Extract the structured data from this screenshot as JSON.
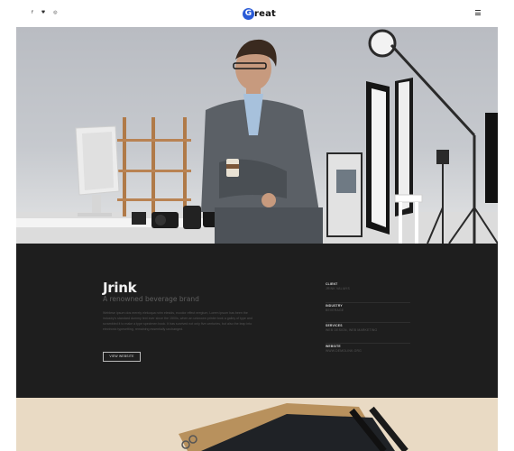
{
  "header": {
    "social_icons": [
      {
        "name": "facebook-icon",
        "glyph": "f"
      },
      {
        "name": "twitter-icon",
        "glyph": "♥"
      },
      {
        "name": "instagram-icon",
        "glyph": "◎"
      }
    ],
    "logo_mark": "G",
    "logo_text": "reat"
  },
  "project": {
    "title": "Jrink",
    "subtitle": "A renowned beverage brand",
    "description": "Weblese ipsum dos merely elekoqua rohn elesids, eccolor effect eregium, Lorem ipsum has been the industry's standard dummy text ever since the 1500s, when an unknown printer took a galley of type and scrambled it to make a type specimen book. It has survived not only five centuries, but also the leap into electronic typesetting, remaining essentially unchanged.",
    "button_label": "VIEW WEBSITE",
    "meta": [
      {
        "label": "CLIENT",
        "value": "JRINK VALIAYS"
      },
      {
        "label": "INDUSTRY",
        "value": "BEVERAGE"
      },
      {
        "label": "SERVICES",
        "value": "WEB DESIGN, WEB MARKETING"
      },
      {
        "label": "WEBSITE",
        "value": "WWW.DEMOLINK.ORG"
      }
    ]
  },
  "colors": {
    "accent": "#2a5bd7",
    "dark_panel": "#1e1e1e"
  }
}
